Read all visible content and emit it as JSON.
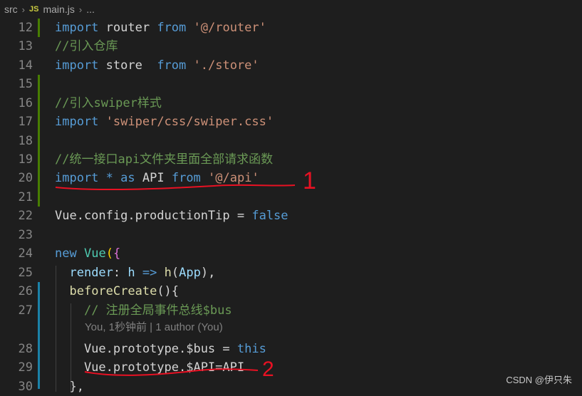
{
  "breadcrumb": {
    "folder": "src",
    "file_icon": "JS",
    "file": "main.js",
    "more": "..."
  },
  "editor": {
    "lines": [
      {
        "n": "12",
        "segs": [
          [
            "k",
            "import"
          ],
          [
            "p",
            " router "
          ],
          [
            "k",
            "from"
          ],
          [
            "p",
            " "
          ],
          [
            "s",
            "'@/router'"
          ]
        ]
      },
      {
        "n": "13",
        "segs": [
          [
            "c",
            "//引入仓库"
          ]
        ]
      },
      {
        "n": "14",
        "segs": [
          [
            "k",
            "import"
          ],
          [
            "p",
            " store  "
          ],
          [
            "k",
            "from"
          ],
          [
            "p",
            " "
          ],
          [
            "s",
            "'./store'"
          ]
        ]
      },
      {
        "n": "15",
        "segs": []
      },
      {
        "n": "16",
        "segs": [
          [
            "c",
            "//引入swiper样式"
          ]
        ]
      },
      {
        "n": "17",
        "segs": [
          [
            "k",
            "import"
          ],
          [
            "p",
            " "
          ],
          [
            "s",
            "'swiper/css/swiper.css'"
          ]
        ]
      },
      {
        "n": "18",
        "segs": []
      },
      {
        "n": "19",
        "segs": [
          [
            "c",
            "//统一接口api文件夹里面全部请求函数"
          ]
        ]
      },
      {
        "n": "20",
        "segs": [
          [
            "k",
            "import"
          ],
          [
            "p",
            " "
          ],
          [
            "k",
            "*"
          ],
          [
            "p",
            " "
          ],
          [
            "k",
            "as"
          ],
          [
            "p",
            " API "
          ],
          [
            "k",
            "from"
          ],
          [
            "p",
            " "
          ],
          [
            "s",
            "'@/api'"
          ]
        ]
      },
      {
        "n": "21",
        "segs": []
      },
      {
        "n": "22",
        "segs": [
          [
            "p",
            "Vue.config.productionTip = "
          ],
          [
            "k",
            "false"
          ]
        ]
      },
      {
        "n": "23",
        "segs": []
      },
      {
        "n": "24",
        "segs": [
          [
            "k",
            "new"
          ],
          [
            "p",
            " "
          ],
          [
            "t",
            "Vue"
          ],
          [
            "br",
            "("
          ],
          [
            "br2",
            "{"
          ]
        ]
      },
      {
        "n": "25",
        "segs": [
          [
            "p",
            "  "
          ],
          [
            "v",
            "render"
          ],
          [
            "p",
            ": "
          ],
          [
            "v",
            "h"
          ],
          [
            "p",
            " "
          ],
          [
            "k",
            "=>"
          ],
          [
            "p",
            " "
          ],
          [
            "f",
            "h"
          ],
          [
            "p",
            "("
          ],
          [
            "v",
            "App"
          ],
          [
            "p",
            "),"
          ]
        ]
      },
      {
        "n": "26",
        "segs": [
          [
            "p",
            "  "
          ],
          [
            "f",
            "beforeCreate"
          ],
          [
            "p",
            "(){"
          ]
        ]
      },
      {
        "n": "27",
        "segs": [
          [
            "p",
            "    "
          ],
          [
            "c",
            "// 注册全局事件总线$bus"
          ]
        ]
      },
      {
        "n": "28",
        "segs": [
          [
            "p",
            "    Vue.prototype.$bus = "
          ],
          [
            "k",
            "this"
          ]
        ]
      },
      {
        "n": "29",
        "segs": [
          [
            "p",
            "    Vue.prototype.$API=API"
          ]
        ]
      },
      {
        "n": "30",
        "segs": [
          [
            "p",
            "  },"
          ]
        ]
      }
    ],
    "blame_text": "You, 1秒钟前 | 1 author (You)"
  },
  "annotations": {
    "mark1": "1",
    "mark2": "2",
    "color": "#e81123"
  },
  "watermark": "CSDN @伊只朱"
}
